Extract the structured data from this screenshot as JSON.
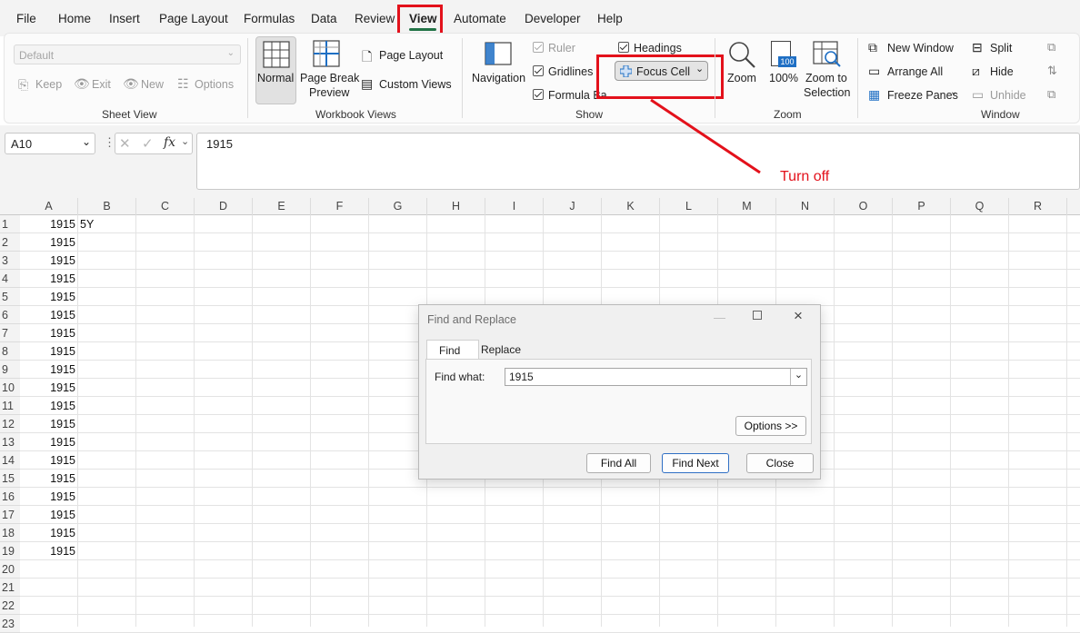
{
  "menu": {
    "items": [
      "File",
      "Home",
      "Insert",
      "Page Layout",
      "Formulas",
      "Data",
      "Review",
      "View",
      "Automate",
      "Developer",
      "Help"
    ],
    "active": "View"
  },
  "ribbon": {
    "sheet_view": {
      "label": "Sheet View",
      "default_select": "Default",
      "keep": "Keep",
      "exit": "Exit",
      "new": "New",
      "options": "Options"
    },
    "workbook_views": {
      "label": "Workbook Views",
      "normal": "Normal",
      "page_break_line1": "Page Break",
      "page_break_line2": "Preview",
      "page_layout": "Page Layout",
      "custom_views": "Custom Views"
    },
    "show": {
      "label": "Show",
      "navigation": "Navigation",
      "ruler": "Ruler",
      "gridlines": "Gridlines",
      "formula_bar": "Formula Bar",
      "headings": "Headings",
      "focus_cell": "Focus Cell"
    },
    "zoom": {
      "label": "Zoom",
      "zoom": "Zoom",
      "hundred": "100%",
      "hundred_icon": "100",
      "zoom_sel_line1": "Zoom to",
      "zoom_sel_line2": "Selection"
    },
    "window": {
      "label": "Window",
      "new_window": "New Window",
      "arrange_all": "Arrange All",
      "freeze_panes": "Freeze Panes",
      "split": "Split",
      "hide": "Hide",
      "unhide": "Unhide"
    }
  },
  "formula_bar": {
    "name_box": "A10",
    "fx": "fx",
    "value": "1915"
  },
  "annotation": {
    "text": "Turn off",
    "color": "#e3111b"
  },
  "grid": {
    "columns": [
      "A",
      "B",
      "C",
      "D",
      "E",
      "F",
      "G",
      "H",
      "I",
      "J",
      "K",
      "L",
      "M",
      "N",
      "O",
      "P",
      "Q",
      "R"
    ],
    "rows": [
      "1",
      "2",
      "3",
      "4",
      "5",
      "6",
      "7",
      "8",
      "9",
      "10",
      "11",
      "12",
      "13",
      "14",
      "15",
      "16",
      "17",
      "18",
      "19",
      "20",
      "21",
      "22",
      "23"
    ],
    "colA": [
      "1915",
      "1915",
      "1915",
      "1915",
      "1915",
      "1915",
      "1915",
      "1915",
      "1915",
      "1915",
      "1915",
      "1915",
      "1915",
      "1915",
      "1915",
      "1915",
      "1915",
      "1915",
      "1915"
    ],
    "b1": "5Y"
  },
  "dialog": {
    "title": "Find and Replace",
    "tab_find": "Find",
    "tab_replace": "Replace",
    "find_label": "Find what:",
    "find_value": "1915",
    "options": "Options >>",
    "find_all": "Find All",
    "find_next": "Find Next",
    "close": "Close"
  },
  "colors": {
    "highlight": "#e3111b",
    "accent": "#217346",
    "dialog_button_focus": "#2f6fc4"
  }
}
